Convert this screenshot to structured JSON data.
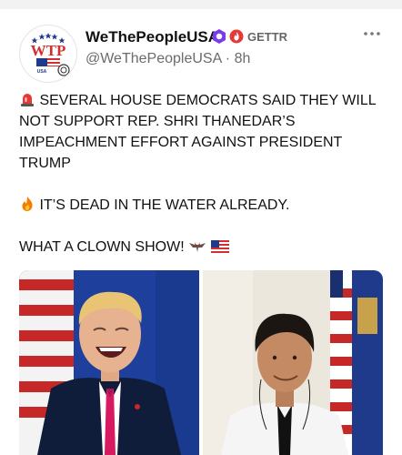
{
  "author": {
    "display_name": "WeThePeopleUSA",
    "handle_line": "@WeThePeopleUSA · 8h",
    "platform_label": "GETTR",
    "avatar_text": "WTP",
    "avatar_subtext": "USA",
    "verified_badge_icon": "hexagon-verified-icon",
    "platform_icon": "gettr-flame-icon"
  },
  "post": {
    "para1_emoji": "siren-icon",
    "para1_text": "SEVERAL HOUSE DEMOCRATS SAID THEY WILL NOT SUPPORT REP. SHRI THANEDAR’S IMPEACHMENT EFFORT AGAINST PRESIDENT TRUMP",
    "para2_emoji": "fire-icon",
    "para2_text": "IT’S DEAD IN THE WATER ALREADY.",
    "para3_text": "WHAT A CLOWN SHOW!",
    "para3_emojis": [
      "eagle-icon",
      "us-flag-icon"
    ]
  },
  "media": {
    "left_image": "photo-man-laughing-podium",
    "right_image": "photo-man-with-flags"
  },
  "colors": {
    "brand_red": "#d32f2f",
    "brand_blue": "#1f3a8a",
    "badge_purple": "#7c3aed",
    "handle_gray": "#6b6b6b"
  }
}
